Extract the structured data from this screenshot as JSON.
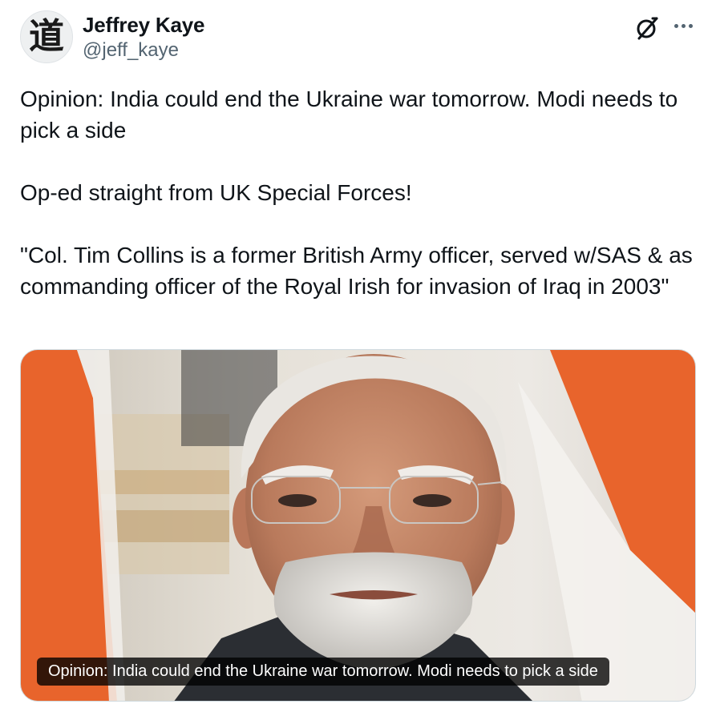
{
  "author": {
    "display_name": "Jeffrey Kaye",
    "handle": "@jeff_kaye",
    "avatar_glyph": "道"
  },
  "actions": {
    "grok_icon": "grok-icon",
    "more_icon": "more-options-icon"
  },
  "tweet": {
    "paragraphs": [
      "Opinion: India could end the Ukraine war tomorrow. Modi needs to pick a side",
      "Op-ed straight from UK Special Forces!",
      "\"Col. Tim Collins is a former British Army officer, served w/SAS & as commanding officer of the Royal Irish for invasion of Iraq in 2003\""
    ]
  },
  "media": {
    "caption": "Opinion: India could end the Ukraine war tomorrow. Modi needs to pick a side"
  },
  "colors": {
    "text_primary": "#0f1419",
    "text_secondary": "#536471",
    "flag_saffron": "#e8642c"
  }
}
